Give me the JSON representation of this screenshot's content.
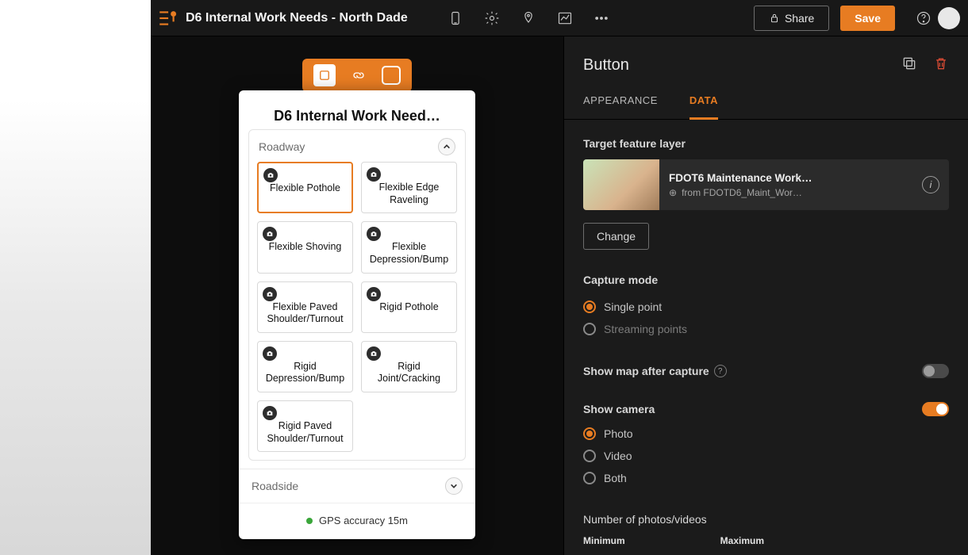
{
  "header": {
    "title": "D6 Internal Work Needs - North Dade",
    "share": "Share",
    "save": "Save"
  },
  "phone": {
    "title": "D6 Internal Work Need…",
    "section_open": "Roadway",
    "tiles": [
      {
        "label": "Flexible Pothole",
        "selected": true
      },
      {
        "label": "Flexible Edge Raveling"
      },
      {
        "label": "Flexible Shoving"
      },
      {
        "label": "Flexible Depression/Bump"
      },
      {
        "label": "Flexible Paved Shoulder/Turnout"
      },
      {
        "label": "Rigid Pothole"
      },
      {
        "label": "Rigid Depression/Bump"
      },
      {
        "label": "Rigid Joint/Cracking"
      },
      {
        "label": "Rigid Paved Shoulder/Turnout"
      }
    ],
    "section_collapsed": "Roadside",
    "gps": "GPS accuracy 15m"
  },
  "panel": {
    "title": "Button",
    "tabs": {
      "appearance": "APPEARANCE",
      "data": "DATA"
    },
    "target_layer_label": "Target feature layer",
    "layer": {
      "name": "FDOT6 Maintenance Work…",
      "source": "from FDOTD6_Maint_Wor…"
    },
    "change": "Change",
    "capture_mode": {
      "label": "Capture mode",
      "single": "Single point",
      "streaming": "Streaming points"
    },
    "show_map": "Show map after capture",
    "show_camera": "Show camera",
    "camera_opts": {
      "photo": "Photo",
      "video": "Video",
      "both": "Both"
    },
    "num_photos": "Number of photos/videos",
    "min": "Minimum",
    "max": "Maximum"
  }
}
